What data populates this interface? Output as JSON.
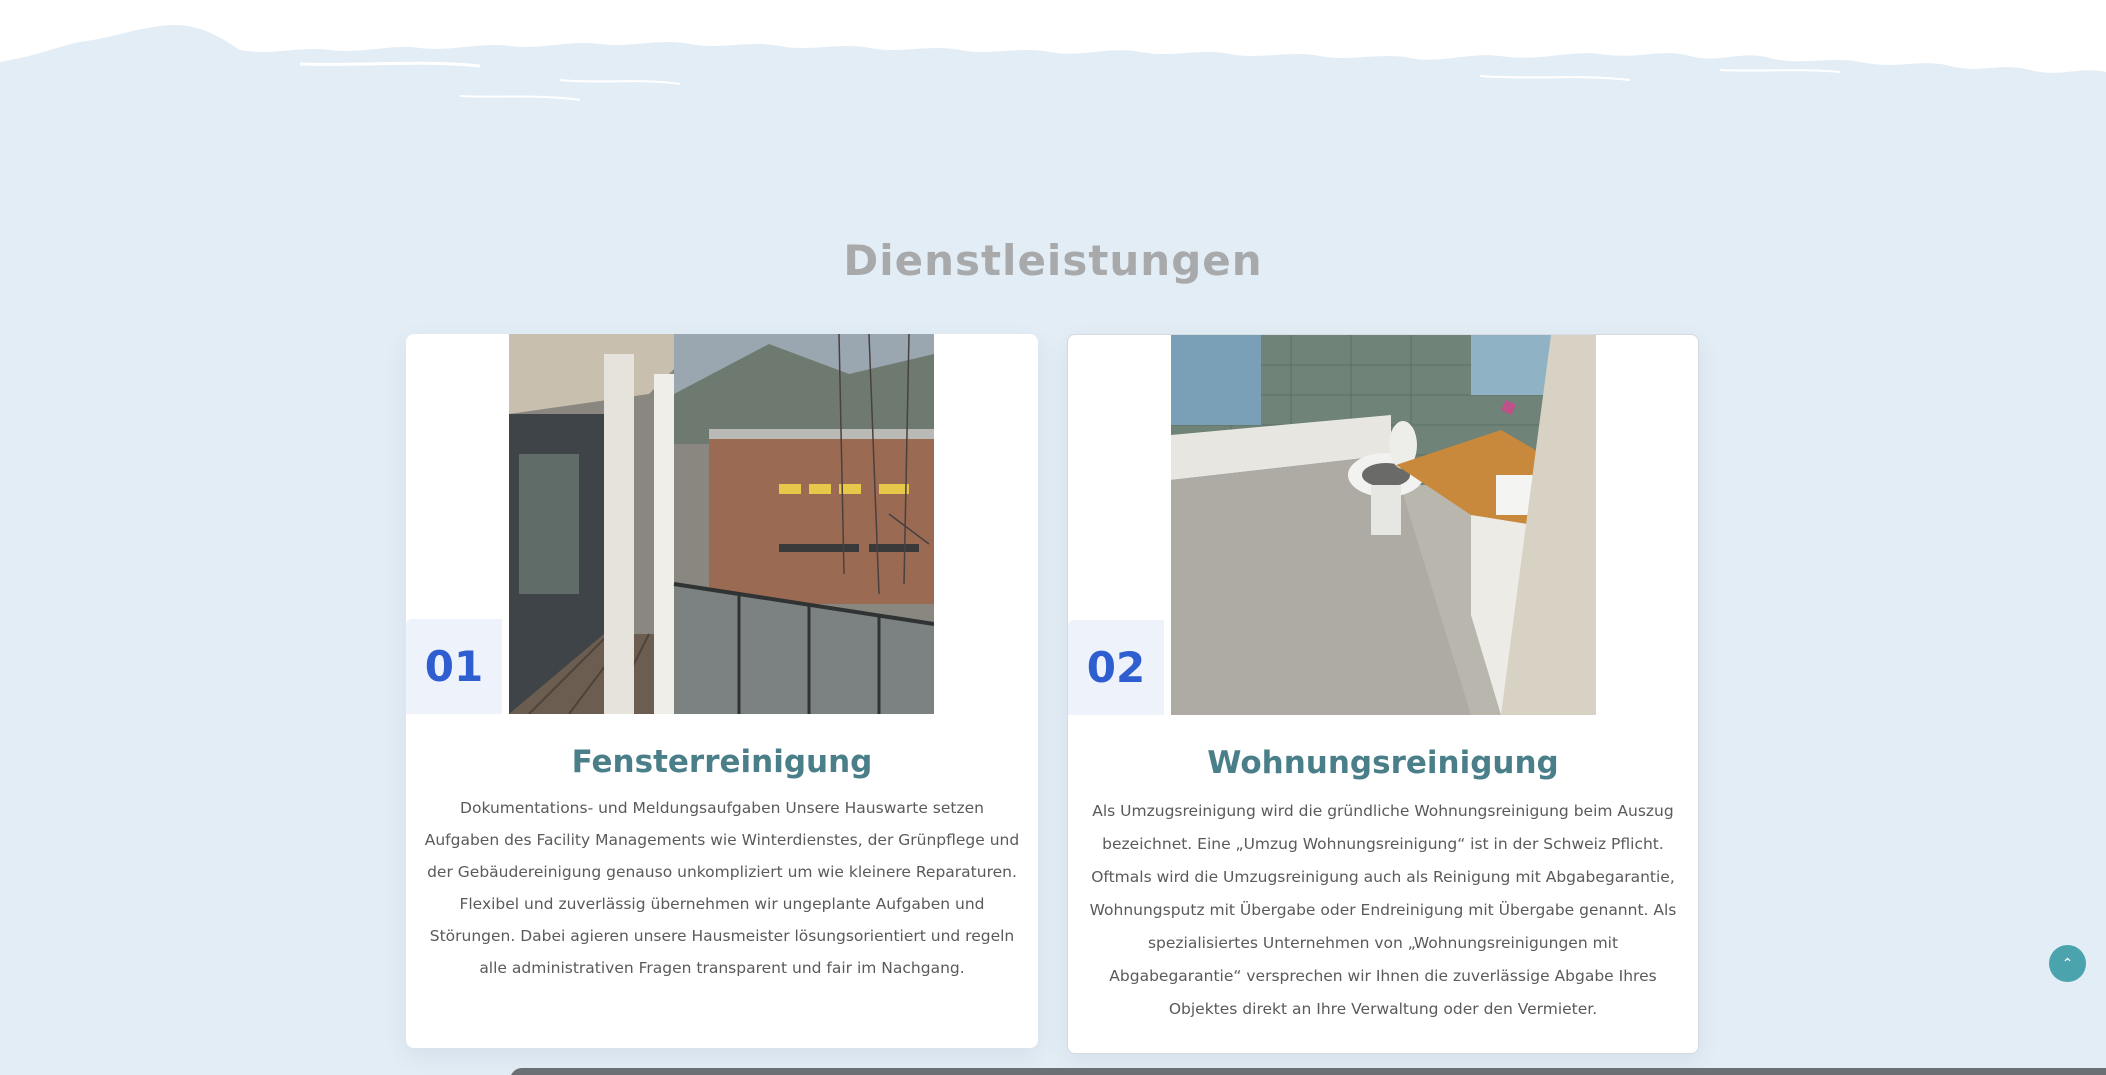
{
  "section": {
    "title": "Dienstleistungen"
  },
  "services": [
    {
      "number": "01",
      "title": "Fensterreinigung",
      "text": "Dokumentations- und Meldungsaufgaben Unsere Hauswarte setzen Aufgaben des Facility Managements wie Winterdienstes, der Grünpflege und der Gebäudereinigung genauso unkompliziert um wie kleinere Reparaturen. Flexibel und zuverlässig übernehmen wir ungeplante Aufgaben und Störungen. Dabei agieren unsere Hausmeister lösungsorientiert und regeln alle administrativen Fragen transparent und fair im Nachgang.",
      "image": "window-balcony-photo"
    },
    {
      "number": "02",
      "title": "Wohnungsreinigung",
      "text": "Als Umzugsreinigung wird die gründliche Wohnungsreinigung beim Auszug bezeichnet. Eine „Umzug Wohnungsreinigung“ ist in der Schweiz Pflicht. Oftmals wird die Umzugsreinigung auch als Reinigung mit Abgabegarantie, Wohnungsputz mit Übergabe oder Endreinigung mit Übergabe genannt. Als spezialisiertes Unternehmen von „Wohnungsreinigungen mit Abgabegarantie“ versprechen wir Ihnen die zuverlässige Abgabe Ihres Objektes direkt an Ihre Verwaltung oder den Vermieter.",
      "image": "bathroom-photo"
    }
  ],
  "scroll_top": {
    "icon": "chevron-up-icon",
    "glyph": "⌃"
  },
  "colors": {
    "background": "#e3edf5",
    "title_gray": "#a8a9ab",
    "number_blue": "#2f5ed0",
    "card_title_teal": "#4a7f8a",
    "button_teal": "#4aa3ad"
  }
}
